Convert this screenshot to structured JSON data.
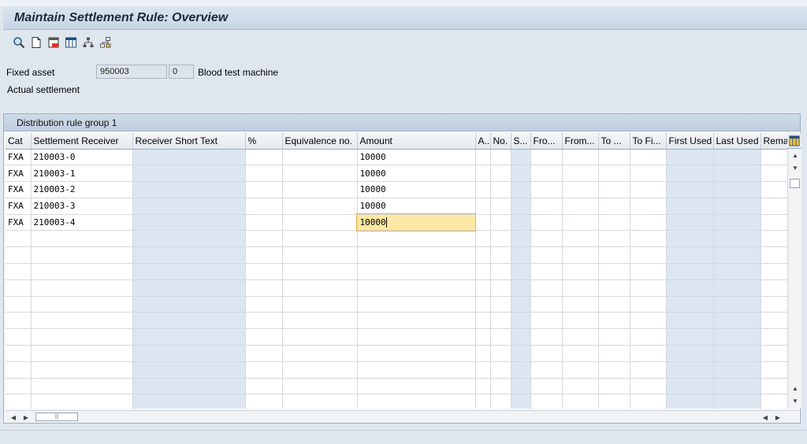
{
  "window": {
    "title": "Maintain Settlement Rule: Overview"
  },
  "toolbar": {
    "buttons": [
      {
        "icon": "magnifier-icon"
      },
      {
        "icon": "new-document-icon"
      },
      {
        "icon": "details-icon"
      },
      {
        "icon": "table-columns-icon"
      },
      {
        "icon": "hierarchy-icon"
      },
      {
        "icon": "structure-icon"
      }
    ]
  },
  "header": {
    "fixed_asset_label": "Fixed asset",
    "asset_number": "950003",
    "sub_number": "0",
    "asset_description": "Blood test machine",
    "settlement_type": "Actual settlement"
  },
  "group": {
    "title": "Distribution rule group 1"
  },
  "table": {
    "columns": [
      "Cat",
      "Settlement Receiver",
      "Receiver Short Text",
      "%",
      "Equivalence no.",
      "Amount",
      "A...",
      "No.",
      "S...",
      "Fro...",
      "From...",
      "To ...",
      "To Fi...",
      "First Used",
      "Last Used",
      "Rema"
    ],
    "rows": [
      [
        "FXA",
        "210003-0",
        "",
        "",
        "",
        "10000",
        "",
        "",
        "",
        "",
        "",
        "",
        "",
        "",
        "",
        ""
      ],
      [
        "FXA",
        "210003-1",
        "",
        "",
        "",
        "10000",
        "",
        "",
        "",
        "",
        "",
        "",
        "",
        "",
        "",
        ""
      ],
      [
        "FXA",
        "210003-2",
        "",
        "",
        "",
        "10000",
        "",
        "",
        "",
        "",
        "",
        "",
        "",
        "",
        "",
        ""
      ],
      [
        "FXA",
        "210003-3",
        "",
        "",
        "",
        "10000",
        "",
        "",
        "",
        "",
        "",
        "",
        "",
        "",
        "",
        ""
      ],
      [
        "FXA",
        "210003-4",
        "",
        "",
        "",
        "10000",
        "",
        "",
        "",
        "",
        "",
        "",
        "",
        "",
        "",
        ""
      ],
      [
        "",
        "",
        "",
        "",
        "",
        "",
        "",
        "",
        "",
        "",
        "",
        "",
        "",
        "",
        "",
        ""
      ],
      [
        "",
        "",
        "",
        "",
        "",
        "",
        "",
        "",
        "",
        "",
        "",
        "",
        "",
        "",
        "",
        ""
      ],
      [
        "",
        "",
        "",
        "",
        "",
        "",
        "",
        "",
        "",
        "",
        "",
        "",
        "",
        "",
        "",
        ""
      ],
      [
        "",
        "",
        "",
        "",
        "",
        "",
        "",
        "",
        "",
        "",
        "",
        "",
        "",
        "",
        "",
        ""
      ],
      [
        "",
        "",
        "",
        "",
        "",
        "",
        "",
        "",
        "",
        "",
        "",
        "",
        "",
        "",
        "",
        ""
      ],
      [
        "",
        "",
        "",
        "",
        "",
        "",
        "",
        "",
        "",
        "",
        "",
        "",
        "",
        "",
        "",
        ""
      ],
      [
        "",
        "",
        "",
        "",
        "",
        "",
        "",
        "",
        "",
        "",
        "",
        "",
        "",
        "",
        "",
        ""
      ],
      [
        "",
        "",
        "",
        "",
        "",
        "",
        "",
        "",
        "",
        "",
        "",
        "",
        "",
        "",
        "",
        ""
      ],
      [
        "",
        "",
        "",
        "",
        "",
        "",
        "",
        "",
        "",
        "",
        "",
        "",
        "",
        "",
        "",
        ""
      ],
      [
        "",
        "",
        "",
        "",
        "",
        "",
        "",
        "",
        "",
        "",
        "",
        "",
        "",
        "",
        "",
        ""
      ],
      [
        "",
        "",
        "",
        "",
        "",
        "",
        "",
        "",
        "",
        "",
        "",
        "",
        "",
        "",
        "",
        ""
      ]
    ],
    "focused_row": 4,
    "focused_col": 5
  }
}
